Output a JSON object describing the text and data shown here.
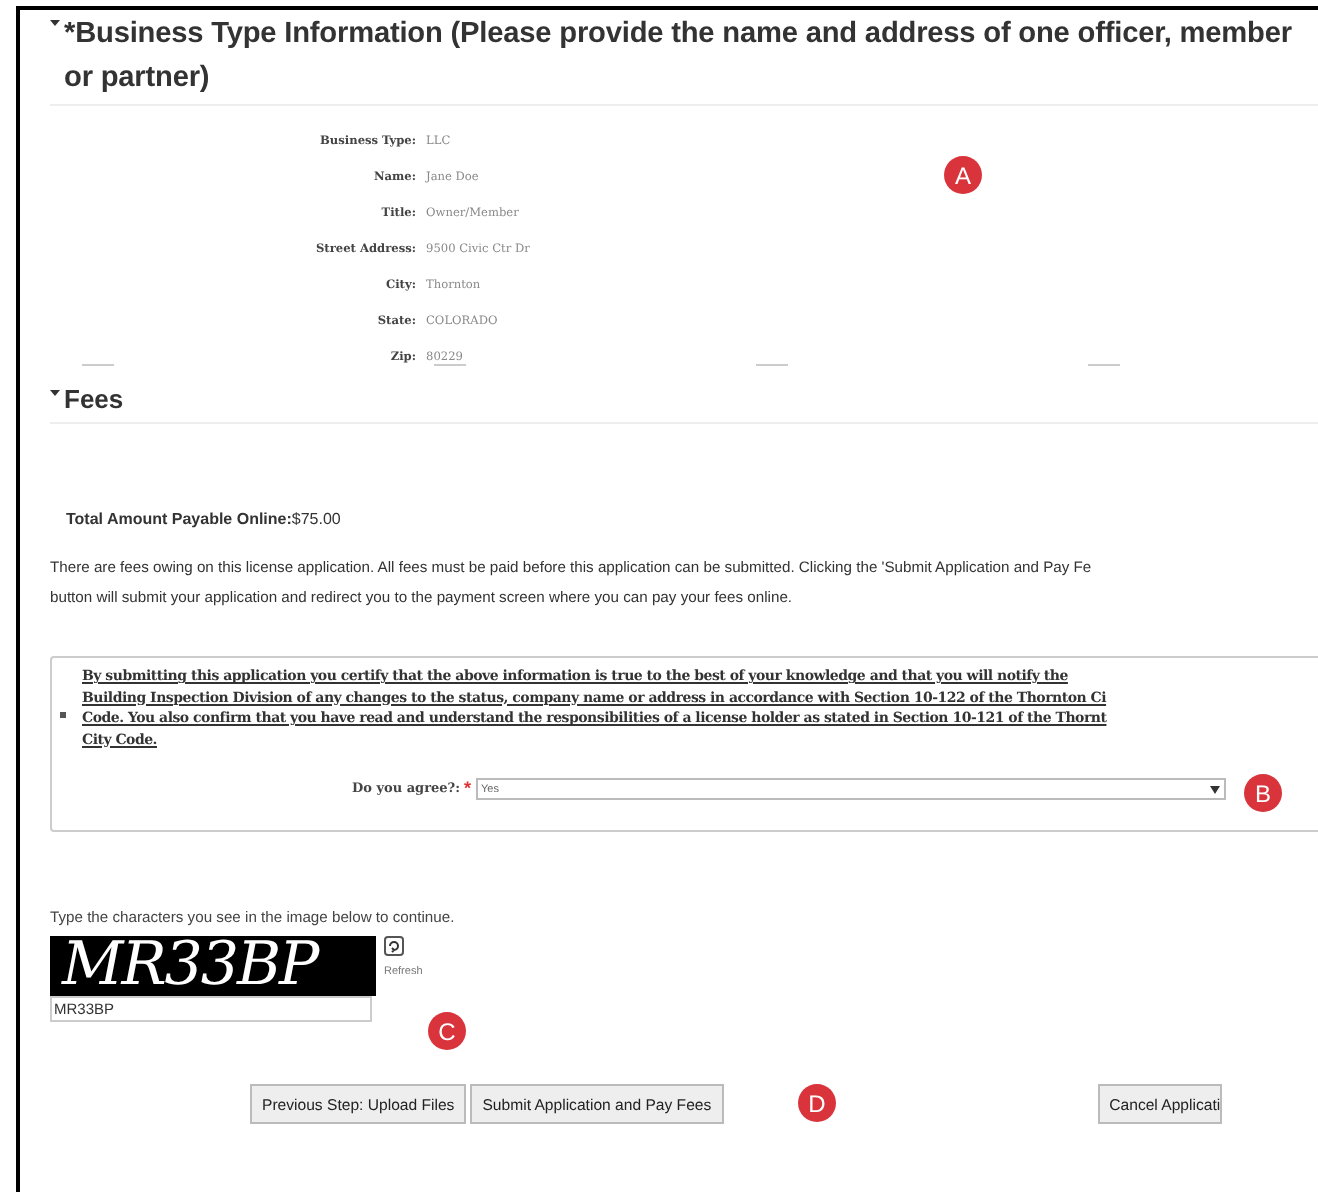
{
  "business_section": {
    "title": "*Business Type Information (Please provide the name and address of one officer, member or partner)",
    "expanded": true,
    "fields": [
      {
        "label": "Business Type:",
        "value": "LLC"
      },
      {
        "label": "Name:",
        "value": "Jane Doe"
      },
      {
        "label": "Title:",
        "value": "Owner/Member"
      },
      {
        "label": "Street Address:",
        "value": "9500 Civic Ctr Dr"
      },
      {
        "label": "City:",
        "value": "Thornton"
      },
      {
        "label": "State:",
        "value": "COLORADO"
      },
      {
        "label": "Zip:",
        "value": "80229"
      }
    ]
  },
  "fees_section": {
    "title": "Fees",
    "expanded": true,
    "total_label": "Total Amount Payable Online:",
    "total_value": "$75.00",
    "notice_lines": [
      "There are fees owing on this license application. All fees must be paid before this application can be submitted. Clicking the 'Submit Application and Pay Fe",
      "button will submit your application and redirect you to the payment screen where you can pay your fees online."
    ]
  },
  "agreement": {
    "lines": [
      "By submitting this application you certify that the above information is true to the best of your knowledge and that you will notify the",
      "Building Inspection Division of any changes to the status, company name or address in accordance with Section 10-122 of the Thornton Ci",
      "Code. You also confirm that you have read and understand the responsibilities of a license holder as stated in Section 10-121 of the Thornt",
      "City Code."
    ],
    "question": "Do you agree?:",
    "required_mark": "*",
    "answer": "Yes"
  },
  "captcha": {
    "prompt": "Type the characters you see in the image below to continue.",
    "image_text": "MR33BP",
    "refresh_label": "Refresh",
    "input_value": "MR33BP"
  },
  "buttons": [
    {
      "label": "Previous Step: Upload Files"
    },
    {
      "label": "Submit Application and Pay Fees"
    },
    {
      "label": "Cancel Applicati"
    }
  ],
  "callouts": [
    {
      "letter": "A"
    },
    {
      "letter": "B"
    },
    {
      "letter": "C"
    },
    {
      "letter": "D"
    }
  ]
}
